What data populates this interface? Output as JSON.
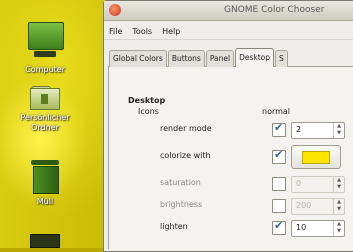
{
  "desktop": {
    "icons": [
      {
        "label": "Computer",
        "icon": "computer-icon"
      },
      {
        "label": "Persönlicher\nOrdner",
        "icon": "home-folder-icon"
      },
      {
        "label": "Müll",
        "icon": "trash-icon"
      },
      {
        "label": "",
        "icon": "drive-icon"
      }
    ]
  },
  "window": {
    "title": "GNOME Color Chooser",
    "menu": [
      "File",
      "Tools",
      "Help"
    ],
    "tabs": [
      {
        "label": "Global Colors",
        "active": false
      },
      {
        "label": "Buttons",
        "active": false
      },
      {
        "label": "Panel",
        "active": false
      },
      {
        "label": "Desktop",
        "active": true
      },
      {
        "label": "S",
        "active": false
      }
    ]
  },
  "desktop_tab": {
    "section_title": "Desktop",
    "frames_label": "Icons",
    "column_header": "normal",
    "rows": [
      {
        "label": "render mode",
        "checked": true,
        "control": "spin",
        "value": "2",
        "enabled": true
      },
      {
        "label": "colorize with",
        "checked": true,
        "control": "color",
        "value": "",
        "color": "#ffe600",
        "enabled": true
      },
      {
        "label": "saturation",
        "checked": false,
        "control": "spin",
        "value": "0",
        "enabled": false
      },
      {
        "label": "brightness",
        "checked": false,
        "control": "spin",
        "value": "200",
        "enabled": false
      },
      {
        "label": "lighten",
        "checked": true,
        "control": "spin",
        "value": "10",
        "enabled": true
      }
    ]
  }
}
